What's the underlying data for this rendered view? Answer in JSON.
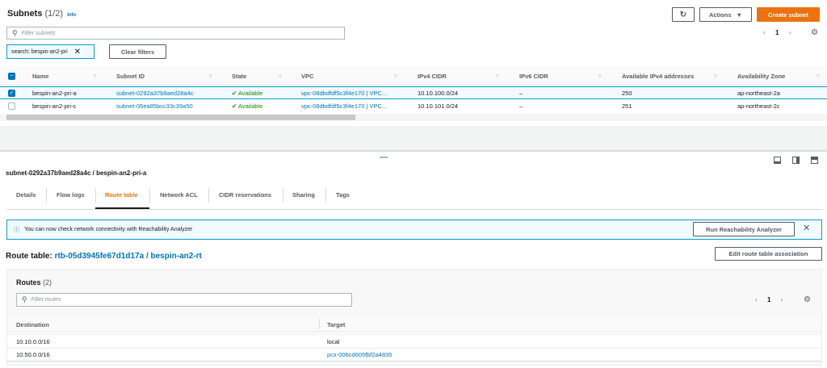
{
  "subnets": {
    "title": "Subnets",
    "count": "(1/2)",
    "info": "Info",
    "filter_placeholder": "Filter subnets",
    "token": "search: bespin-an2-pri",
    "clear_filters": "Clear filters",
    "actions": "Actions",
    "create": "Create subnet",
    "page": "1",
    "columns": [
      "Name",
      "Subnet ID",
      "State",
      "VPC",
      "IPv4 CIDR",
      "IPv6 CIDR",
      "Available IPv4 addresses",
      "Availability Zone"
    ],
    "rows": [
      {
        "name": "bespin-an2-pri-a",
        "id": "subnet-0292a37b9aed28a4c",
        "state": "Available",
        "vpc": "vpc-08dbdfdf5c3f4e170 | VPC...",
        "ipv4": "10.10.100.0/24",
        "ipv6": "–",
        "avail": "250",
        "az": "ap-northeast-2a",
        "selected": true
      },
      {
        "name": "bespin-an2-pri-c",
        "id": "subnet-05ea85bcc33c39a50",
        "state": "Available",
        "vpc": "vpc-08dbdfdf5c3f4e170 | VPC...",
        "ipv4": "10.10.101.0/24",
        "ipv6": "–",
        "avail": "251",
        "az": "ap-northeast-2c",
        "selected": false
      }
    ]
  },
  "detail": {
    "title": "subnet-0292a37b9aed28a4c / bespin-an2-pri-a",
    "tabs": [
      "Details",
      "Flow logs",
      "Route table",
      "Network ACL",
      "CIDR reservations",
      "Sharing",
      "Tags"
    ],
    "active_tab": "Route table",
    "alert": "You can now check network connectivity with Reachability Analyzer",
    "run_analyzer": "Run Reachability Analyzer",
    "rt_label": "Route table:",
    "rt_link": "rtb-05d3945fe67d1d17a / bespin-an2-rt",
    "edit_assoc": "Edit route table association",
    "routes_title": "Routes",
    "routes_count": "(2)",
    "routes_filter_placeholder": "Filter routes",
    "page": "1",
    "route_columns": [
      "Destination",
      "Target"
    ],
    "routes": [
      {
        "dest": "10.10.0.0/16",
        "target": "local"
      },
      {
        "dest": "10.50.0.0/16",
        "target": "pcx-006cd605fbf2a4835"
      }
    ]
  }
}
